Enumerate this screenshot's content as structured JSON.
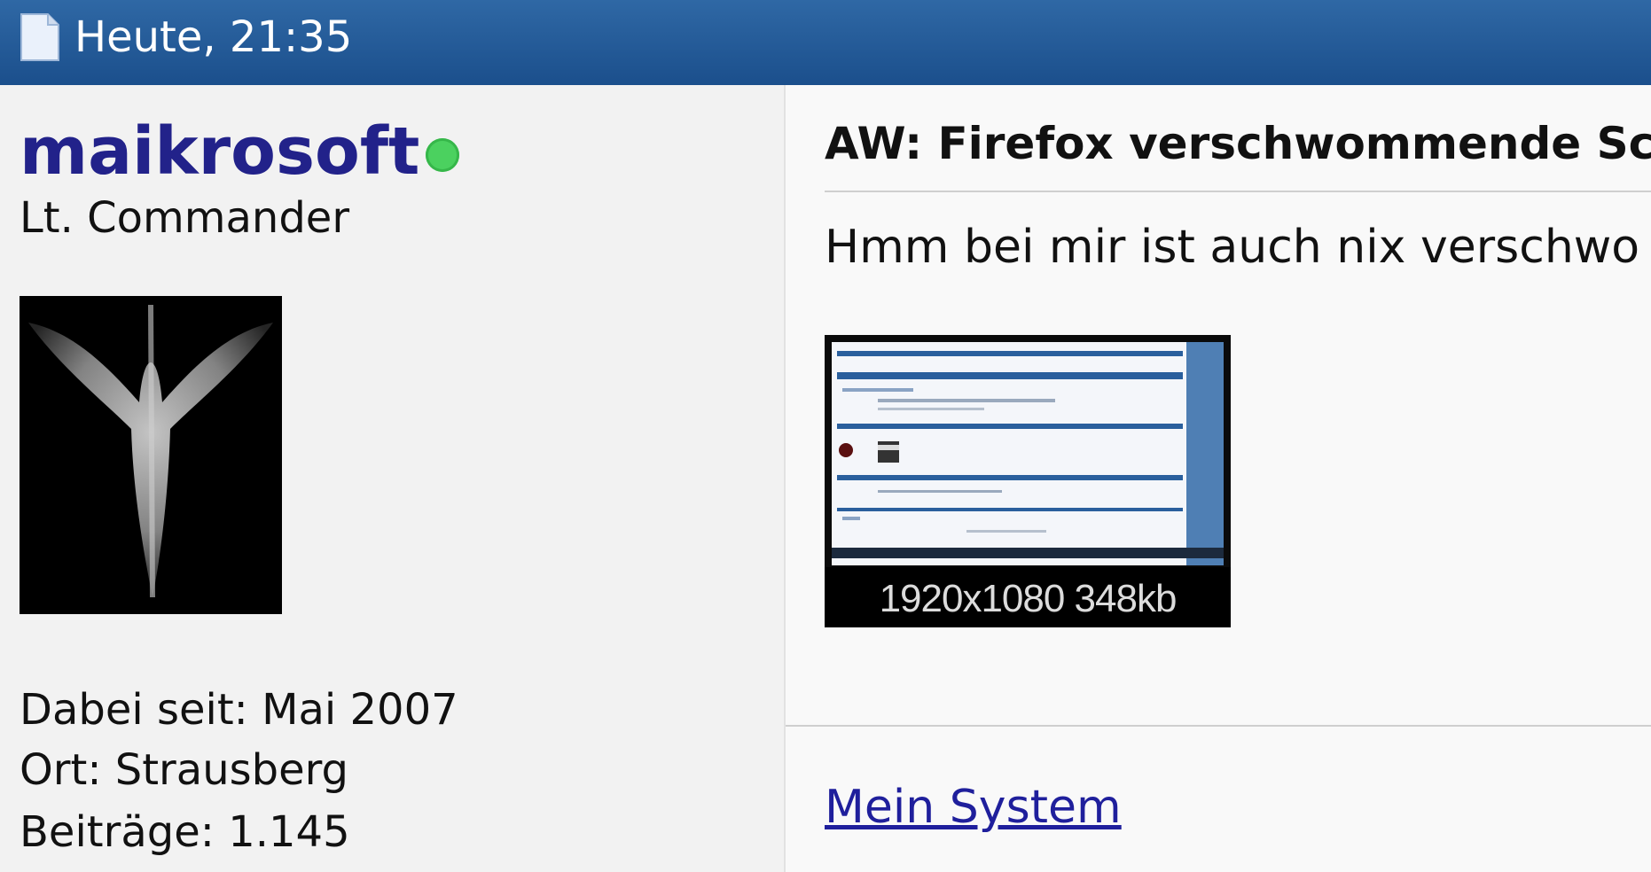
{
  "header": {
    "post_date": "Heute, 21:35",
    "icon": "document-icon"
  },
  "user": {
    "name": "maikrosoft",
    "rank": "Lt. Commander",
    "status": "online",
    "status_color": "#4bd15f",
    "name_color": "#22228a",
    "joined": "Dabei seit: Mai 2007",
    "location": "Ort: Strausberg",
    "posts": "Beiträge: 1.145"
  },
  "post": {
    "title": "AW: Firefox verschwommende Sc",
    "text": "Hmm bei mir ist auch nix verschwo",
    "attachment_caption": "1920x1080 348kb",
    "signature_link": "Mein System"
  },
  "colors": {
    "header_bar": "#1b4f8c",
    "link": "#1f1f9c"
  }
}
